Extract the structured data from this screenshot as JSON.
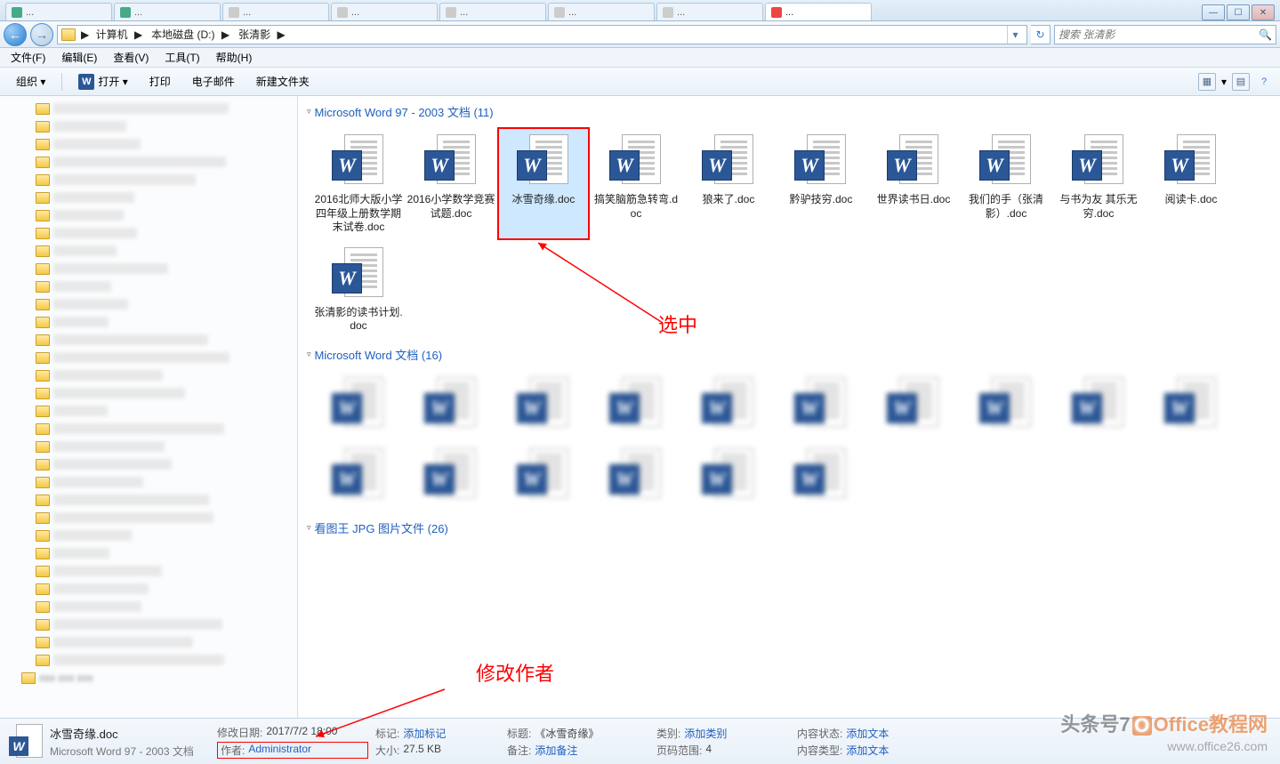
{
  "window": {
    "controls": {
      "min": "—",
      "max": "☐",
      "close": "✕"
    }
  },
  "browser_tabs": [
    {
      "text": "..."
    },
    {
      "text": "..."
    },
    {
      "text": "..."
    },
    {
      "text": "..."
    },
    {
      "text": "..."
    },
    {
      "text": "..."
    },
    {
      "text": "..."
    },
    {
      "text": "...",
      "active": true
    }
  ],
  "address": {
    "crumbs": [
      "计算机",
      "本地磁盘 (D:)",
      "张清影"
    ],
    "sep": "▶",
    "dropdown": "▾",
    "refresh": "↻"
  },
  "search": {
    "placeholder": "搜索 张清影",
    "icon": "🔍"
  },
  "menubar": [
    "文件(F)",
    "编辑(E)",
    "查看(V)",
    "工具(T)",
    "帮助(H)"
  ],
  "toolbar": {
    "organize": "组织 ▾",
    "open": "打开 ▾",
    "print": "打印",
    "email": "电子邮件",
    "newfolder": "新建文件夹",
    "view_drop": "▾",
    "help": "?"
  },
  "groups": [
    {
      "title": "Microsoft Word 97 - 2003 文档 (11)",
      "files": [
        {
          "name": "2016北师大版小学四年级上册数学期末试卷.doc"
        },
        {
          "name": "2016小学数学竞赛试题.doc"
        },
        {
          "name": "冰雪奇缘.doc",
          "selected": true,
          "highlight": true
        },
        {
          "name": "搞笑脑筋急转弯.doc"
        },
        {
          "name": "狼来了.doc"
        },
        {
          "name": "黔驴技穷.doc"
        },
        {
          "name": "世界读书日.doc"
        },
        {
          "name": "我们的手（张清影）.doc"
        },
        {
          "name": "与书为友 其乐无穷.doc"
        },
        {
          "name": "阅读卡.doc"
        },
        {
          "name": "张清影的读书计划.doc"
        }
      ]
    },
    {
      "title": "Microsoft Word 文档 (16)",
      "files": [
        {
          "name": " ",
          "blur": true
        },
        {
          "name": " ",
          "blur": true
        },
        {
          "name": " ",
          "blur": true
        },
        {
          "name": " ",
          "blur": true
        },
        {
          "name": " ",
          "blur": true
        },
        {
          "name": " ",
          "blur": true
        },
        {
          "name": " ",
          "blur": true
        },
        {
          "name": " ",
          "blur": true
        },
        {
          "name": " ",
          "blur": true
        },
        {
          "name": " ",
          "blur": true
        },
        {
          "name": " ",
          "blur": true
        },
        {
          "name": " ",
          "blur": true
        },
        {
          "name": " ",
          "blur": true
        },
        {
          "name": " ",
          "blur": true
        },
        {
          "name": " ",
          "blur": true
        },
        {
          "name": " ",
          "blur": true
        }
      ]
    },
    {
      "title": "看图王 JPG 图片文件 (26)",
      "files": []
    }
  ],
  "details": {
    "filename": "冰雪奇缘.doc",
    "filetype": "Microsoft Word 97 - 2003 文档",
    "fields": {
      "mod_lbl": "修改日期:",
      "mod_val": "2017/7/2 18:00",
      "author_lbl": "作者:",
      "author_val": "Administrator",
      "tag_lbl": "标记:",
      "tag_val": "添加标记",
      "size_lbl": "大小:",
      "size_val": "27.5 KB",
      "title_lbl": "标题:",
      "title_val": "《冰雪奇缘》",
      "remark_lbl": "备注:",
      "remark_val": "添加备注",
      "cat_lbl": "类别:",
      "cat_val": "添加类别",
      "pages_lbl": "页码范围:",
      "pages_val": "4",
      "status_lbl": "内容状态:",
      "status_val": "添加文本",
      "ctype_lbl": "内容类型:",
      "ctype_val": "添加文本"
    }
  },
  "annotations": {
    "select": "选中",
    "modify": "修改作者"
  },
  "watermark": {
    "line1_a": "头条号7",
    "line1_b": "Office教程网",
    "line2": "www.office26.com"
  }
}
